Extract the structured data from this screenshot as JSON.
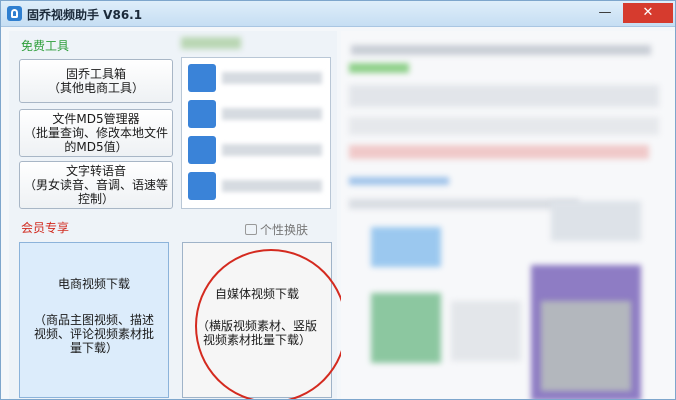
{
  "window": {
    "title": "固乔视频助手 V86.1",
    "minimize_label": "—",
    "close_label": "✕"
  },
  "free_tools": {
    "title": "免费工具",
    "buttons": [
      {
        "lines": [
          "固乔工具箱",
          "（其他电商工具）"
        ]
      },
      {
        "lines": [
          "文件MD5管理器",
          "（批量查询、修改本地文件",
          "的MD5值）"
        ]
      },
      {
        "lines": [
          "文字转语音",
          "（男女读音、音调、语速等",
          "控制）"
        ]
      }
    ]
  },
  "skin_label": "个性换肤",
  "vip": {
    "title": "会员专享",
    "left": {
      "lines": [
        "电商视频下载",
        "",
        "（商品主图视频、描述",
        "视频、评论视频素材批",
        "量下载）"
      ]
    },
    "right": {
      "lines": [
        "自媒体视频下载",
        "",
        "（横版视频素材、竖版",
        "视频素材批量下载）"
      ]
    }
  },
  "colors": {
    "accent": "#d42a1f",
    "section_green": "#2e9e3a",
    "vip_red": "#d12b20"
  }
}
